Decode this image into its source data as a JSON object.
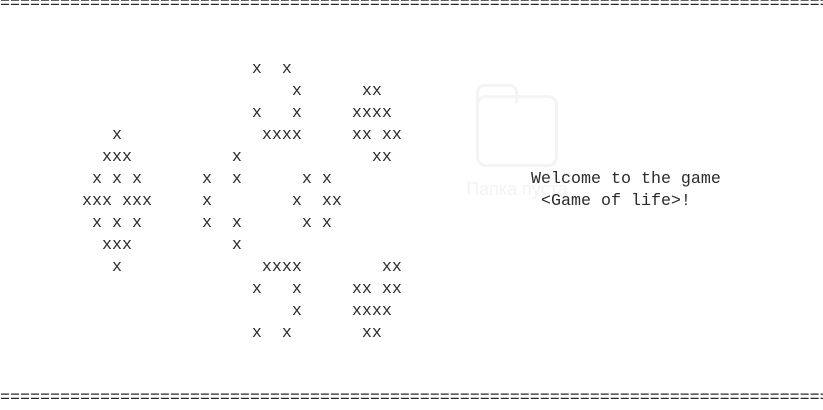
{
  "separator": "====================================================================================",
  "grid_rows": [
    "                 x  x",
    "                     x      xx",
    "                 x   x     xxxx",
    "   x              xxxx     xx xx",
    "  xxx          x             xx",
    " x x x      x  x      x x",
    "xxx xxx     x        x  xx",
    " x x x      x  x      x x",
    "  xxx          x",
    "   x              xxxx        xx",
    "                 x   x     xx xx",
    "                     x     xxxx",
    "                 x  x       xx"
  ],
  "welcome": {
    "line1": "Welcome to the game",
    "line2": " <Game of life>!"
  },
  "watermark": {
    "icon": "folder-icon",
    "text": "Папка пуста"
  }
}
